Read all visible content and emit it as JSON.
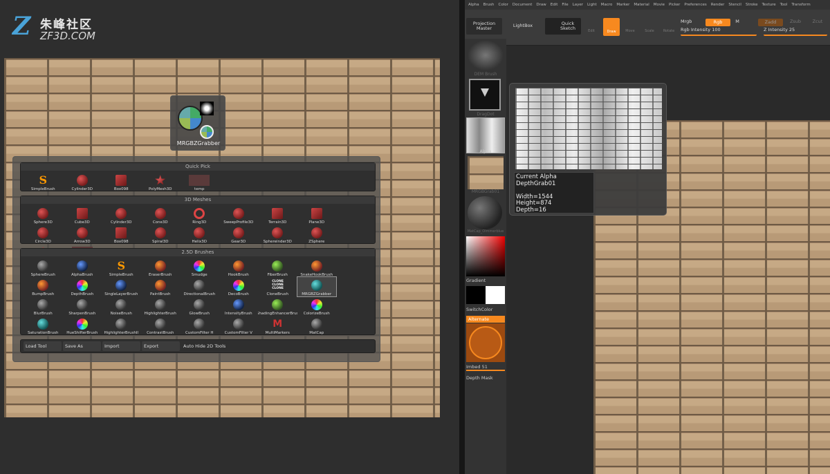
{
  "logo": {
    "glyph": "Z",
    "cn": "朱峰社区",
    "en": "ZF3D.COM"
  },
  "tool_icon": {
    "label": "MRGBZGrabber"
  },
  "quick_pick": {
    "title": "Quick Pick",
    "items": [
      "SimpleBrush",
      "Cylinder3D",
      "Box098",
      "PolyMesh3D",
      "temp"
    ]
  },
  "meshes_3d": {
    "title": "3D Meshes",
    "items": [
      "Sphere3D",
      "Cube3D",
      "Cylinder3D",
      "Cone3D",
      "Ring3D",
      "SweepProfile3D",
      "Terrain3D",
      "Plane3D",
      "Circle3D",
      "Arrow3D",
      "Box098",
      "Spiral3D",
      "Helix3D",
      "Gear3D",
      "Sphereinder3D",
      "ZSphere",
      "PolyMesh3D",
      "temp"
    ]
  },
  "brushes_25d": {
    "title": "2.5D Brushes",
    "items": [
      "SphereBrush",
      "AlphaBrush",
      "SimpleBrush",
      "EraserBrush",
      "Smudge",
      "HookBrush",
      "FiberBrush",
      "SnakeHookBrush",
      "BumpBrush",
      "DepthBrush",
      "SingleLayerBrush",
      "PaintBrush",
      "DirectionalBrush",
      "DecoBrush",
      "CloneBrush",
      "MRGBZGrabber",
      "BlurBrush",
      "SharpenBrush",
      "NoiseBrush",
      "HighlighterBrush",
      "GlowBrush",
      "IntensityBrush",
      "ShadingEnhancerBrus",
      "ColorizeBrush",
      "SaturationBrush",
      "HueShifterBrush",
      "HighlighterBrushII",
      "ContrastBrush",
      "CustomFilter H",
      "CustomFilter V",
      "MultiMarkers",
      "MatCap"
    ],
    "clone_text": "CLONE\nCLONE\nCLONE"
  },
  "bottom": {
    "load": "Load Tool",
    "save": "Save As",
    "import": "Import",
    "export": "Export",
    "autohide": "Auto Hide 2D Tools"
  },
  "menu": [
    "Alpha",
    "Brush",
    "Color",
    "Document",
    "Draw",
    "Edit",
    "File",
    "Layer",
    "Light",
    "Macro",
    "Marker",
    "Material",
    "Movie",
    "Picker",
    "Preferences",
    "Render",
    "Stencil",
    "Stroke",
    "Texture",
    "Tool",
    "Transform"
  ],
  "topbar": {
    "projection": "Projection\nMaster",
    "lightbox": "LightBox",
    "quicksketch": "Quick\nSketch",
    "edit": "Edit",
    "draw": "Draw",
    "move": "Move",
    "scale": "Scale",
    "rotate": "Rotate",
    "mrgb": "Mrgb",
    "rgb": "Rgb",
    "m": "M",
    "zadd": "Zadd",
    "zsub": "Zsub",
    "zcut": "Zcut",
    "rgb_intensity": "Rgb Intensity 100",
    "z_intensity": "Z Intensity 25"
  },
  "shelf": {
    "brush": "DEM Brush",
    "stroke": "DragDot",
    "alpha": "Alpha",
    "texture": "MRGBGrab01",
    "material": "MatCap_Olmmerblue",
    "gradient": "Gradient",
    "switchcolor": "SwitchColor",
    "alternate": "Alternate",
    "imbed": "Imbed 51",
    "depthmask": "Depth Mask"
  },
  "tooltip": {
    "text": "Current Alpha\nDepthGrab01\n\nWidth=1544\nHeight=874\nDepth=16"
  }
}
